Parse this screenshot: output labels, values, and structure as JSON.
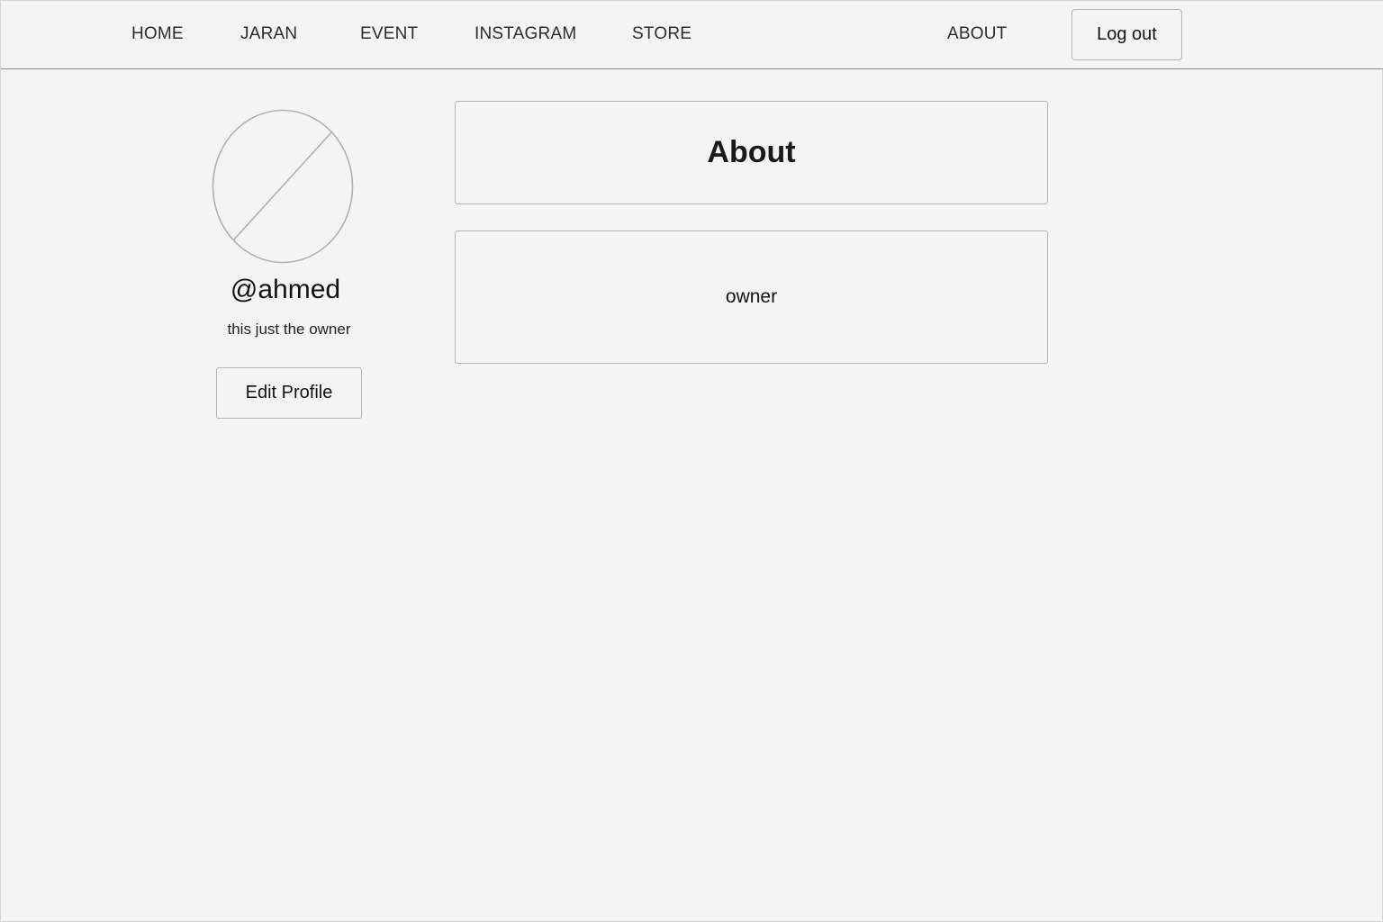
{
  "nav": {
    "items": [
      {
        "label": "HOME"
      },
      {
        "label": "JARAN"
      },
      {
        "label": "EVENT"
      },
      {
        "label": "INSTAGRAM"
      },
      {
        "label": "STORE"
      },
      {
        "label": "ABOUT"
      }
    ],
    "logout_label": "Log out"
  },
  "profile": {
    "avatar_icon": "avatar-placeholder-icon",
    "username": "@ahmed",
    "bio": "this just the owner",
    "edit_label": "Edit Profile"
  },
  "about": {
    "title": "About",
    "content": "owner"
  },
  "colors": {
    "background": "#f4f4f4",
    "border": "#b4b4b4",
    "nav_divider": "#8a8a8a"
  }
}
